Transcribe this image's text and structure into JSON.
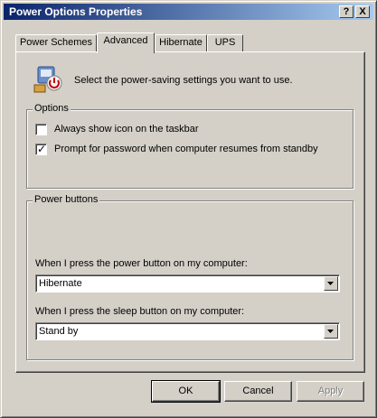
{
  "window": {
    "title": "Power Options Properties",
    "help_glyph": "?",
    "close_glyph": "X"
  },
  "tabs": [
    {
      "label": "Power Schemes"
    },
    {
      "label": "Advanced"
    },
    {
      "label": "Hibernate"
    },
    {
      "label": "UPS"
    }
  ],
  "active_tab": "Advanced",
  "intro": {
    "icon": "power-settings-icon",
    "text": "Select the power-saving settings you want to use."
  },
  "options": {
    "legend": "Options",
    "always_show_icon": {
      "label": "Always show icon on the taskbar",
      "checked": false
    },
    "prompt_password": {
      "label": "Prompt for password when computer resumes from standby",
      "checked": true
    }
  },
  "power_buttons": {
    "legend": "Power buttons",
    "power_button_label": "When I press the power button on my computer:",
    "power_button_value": "Hibernate",
    "sleep_button_label": "When I press the sleep button on my computer:",
    "sleep_button_value": "Stand by"
  },
  "buttons": {
    "ok": "OK",
    "cancel": "Cancel",
    "apply": "Apply"
  },
  "colors": {
    "face": "#d4d0c8",
    "titlebar_start": "#0a246a",
    "titlebar_end": "#a6caf0"
  }
}
